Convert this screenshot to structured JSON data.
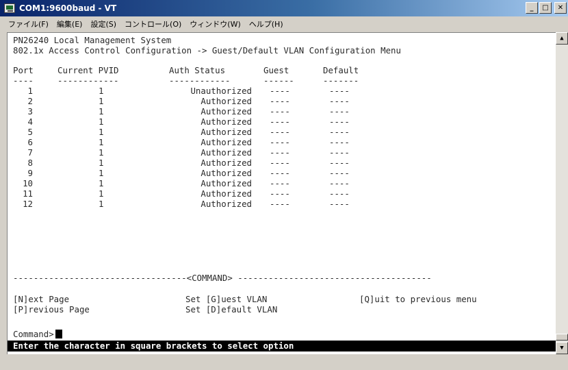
{
  "window": {
    "title": "COM1:9600baud - VT"
  },
  "menubar": {
    "items": [
      "ファイル(F)",
      "編集(E)",
      "設定(S)",
      "コントロール(O)",
      "ウィンドウ(W)",
      "ヘルプ(H)"
    ]
  },
  "terminal": {
    "system_title": "PN26240 Local Management System",
    "breadcrumb": "802.1x Access Control Configuration -> Guest/Default VLAN Configuration Menu",
    "headers": [
      "Port",
      "Current PVID",
      "Auth Status",
      "Guest",
      "Default"
    ],
    "rows": [
      {
        "port": "1",
        "pvid": "1",
        "status": "Unauthorized",
        "guest": "----",
        "default": "----"
      },
      {
        "port": "2",
        "pvid": "1",
        "status": "Authorized",
        "guest": "----",
        "default": "----"
      },
      {
        "port": "3",
        "pvid": "1",
        "status": "Authorized",
        "guest": "----",
        "default": "----"
      },
      {
        "port": "4",
        "pvid": "1",
        "status": "Authorized",
        "guest": "----",
        "default": "----"
      },
      {
        "port": "5",
        "pvid": "1",
        "status": "Authorized",
        "guest": "----",
        "default": "----"
      },
      {
        "port": "6",
        "pvid": "1",
        "status": "Authorized",
        "guest": "----",
        "default": "----"
      },
      {
        "port": "7",
        "pvid": "1",
        "status": "Authorized",
        "guest": "----",
        "default": "----"
      },
      {
        "port": "8",
        "pvid": "1",
        "status": "Authorized",
        "guest": "----",
        "default": "----"
      },
      {
        "port": "9",
        "pvid": "1",
        "status": "Authorized",
        "guest": "----",
        "default": "----"
      },
      {
        "port": "10",
        "pvid": "1",
        "status": "Authorized",
        "guest": "----",
        "default": "----"
      },
      {
        "port": "11",
        "pvid": "1",
        "status": "Authorized",
        "guest": "----",
        "default": "----"
      },
      {
        "port": "12",
        "pvid": "1",
        "status": "Authorized",
        "guest": "----",
        "default": "----"
      }
    ],
    "command_divider_label": "<COMMAND>",
    "options": {
      "next_page": "[N]ext Page",
      "previous_page": "[P]revious Page",
      "set_guest": "Set [G]uest VLAN",
      "set_default": "Set [D]efault VLAN",
      "quit": "[Q]uit to previous menu"
    },
    "command_prompt": "Command>",
    "status_message": "Enter the character in square brackets to select option"
  }
}
